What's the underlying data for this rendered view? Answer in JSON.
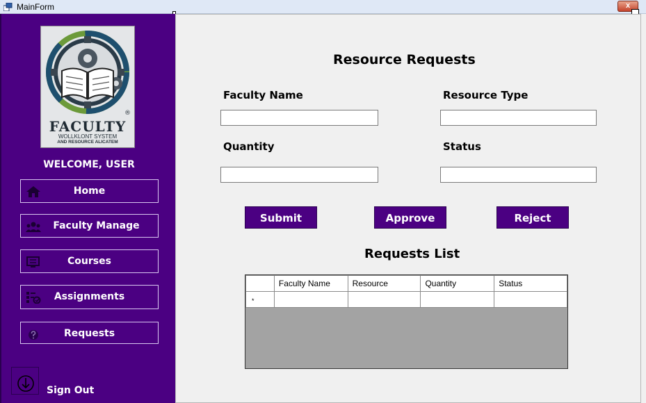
{
  "window": {
    "title": "MainForm",
    "close_glyph": "x"
  },
  "sidebar": {
    "logo": {
      "brand": "FACULTY",
      "tagline_1": "WOLLKLONT SYSTEM",
      "tagline_2": "AND RESOURCE ALICATEM",
      "reg_mark": "®"
    },
    "welcome": "WELCOME, USER",
    "items": [
      {
        "label": "Home",
        "icon": "home-icon"
      },
      {
        "label": "Faculty Manage",
        "icon": "people-icon"
      },
      {
        "label": "Courses",
        "icon": "monitor-icon"
      },
      {
        "label": "Assignments",
        "icon": "checklist-icon"
      },
      {
        "label": "Requests",
        "icon": "question-icon"
      }
    ],
    "sign_out": "Sign Out"
  },
  "main": {
    "title": "Resource Requests",
    "fields": {
      "faculty_name": {
        "label": "Faculty Name",
        "value": ""
      },
      "resource_type": {
        "label": "Resource Type",
        "value": ""
      },
      "quantity": {
        "label": "Quantity",
        "value": ""
      },
      "status": {
        "label": "Status",
        "value": ""
      }
    },
    "buttons": {
      "submit": "Submit",
      "approve": "Approve",
      "reject": "Reject"
    },
    "list_title": "Requests List",
    "table": {
      "columns": [
        "Faculty Name",
        "Resource",
        "Quantity",
        "Status"
      ],
      "new_row_marker": "*"
    }
  },
  "colors": {
    "sidebar": "#4b0082",
    "button": "#4b0082",
    "background": "#f0f0f0"
  }
}
